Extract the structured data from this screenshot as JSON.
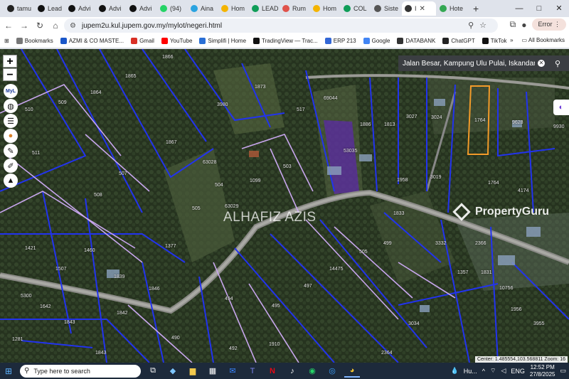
{
  "browser": {
    "tabs": [
      {
        "label": "tamu",
        "icon": "github-icon",
        "color": "#222222"
      },
      {
        "label": "Lead",
        "icon": "tiktok-icon",
        "color": "#111111"
      },
      {
        "label": "Advi",
        "icon": "tiktok-icon",
        "color": "#111111"
      },
      {
        "label": "Advi",
        "icon": "tiktok-icon",
        "color": "#111111"
      },
      {
        "label": "Advi",
        "icon": "tiktok-icon",
        "color": "#111111"
      },
      {
        "label": "(94)",
        "icon": "whatsapp-icon",
        "color": "#25d366"
      },
      {
        "label": "Aina",
        "icon": "telegram-icon",
        "color": "#2aa3e0"
      },
      {
        "label": "Hom",
        "icon": "drive-icon",
        "color": "#f4b400"
      },
      {
        "label": "LEAD",
        "icon": "sheets-icon",
        "color": "#0f9d58"
      },
      {
        "label": "Rum",
        "icon": "rumah-icon",
        "color": "#e0524a"
      },
      {
        "label": "Hom",
        "icon": "drive-icon",
        "color": "#f4b400"
      },
      {
        "label": "COL",
        "icon": "sheets-icon",
        "color": "#0f9d58"
      },
      {
        "label": "Siste",
        "icon": "globe-icon",
        "color": "#555555"
      },
      {
        "label": "I",
        "icon": "mylot-icon",
        "color": "#333333",
        "active": true
      },
      {
        "label": "Hote",
        "icon": "maps-pin-icon",
        "color": "#34a853"
      }
    ],
    "new_tab": "+",
    "window_controls": [
      "—",
      "□",
      "✕"
    ],
    "url": "jupem2u.kul.jupem.gov.my/mylot/negeri.html",
    "error_label": "Error",
    "bookmarks": [
      {
        "label": "Bookmarks",
        "color": "#777777"
      },
      {
        "label": "AZMI & CO MASTE...",
        "color": "#1a57c9"
      },
      {
        "label": "Gmail",
        "color": "#d93025"
      },
      {
        "label": "YouTube",
        "color": "#ff0000"
      },
      {
        "label": "Simplifi | Home",
        "color": "#2a6fd6"
      },
      {
        "label": "TradingView — Trac...",
        "color": "#111111"
      },
      {
        "label": "ERP 213",
        "color": "#3367d6"
      },
      {
        "label": "Google",
        "color": "#4285f4"
      },
      {
        "label": "DATABANK",
        "color": "#333333"
      },
      {
        "label": "ChatGPT",
        "color": "#222222"
      },
      {
        "label": "TikTok",
        "color": "#111111"
      }
    ],
    "bookmarks_overflow": "»",
    "all_bookmarks": "All Bookmarks"
  },
  "map": {
    "zoom_in": "+",
    "zoom_out": "−",
    "side_tools": [
      "mylot-logo-icon",
      "globe-icon",
      "layers-icon",
      "user-pin-icon",
      "measure-icon",
      "draw-icon",
      "north-arrow-icon"
    ],
    "search_text": "Jalan Besar, Kampung Ulu Pulai, Iskandar Puteri",
    "watermark": "ALHAFIZ AZIS",
    "brand": "PropertyGuru",
    "coords_text": "Center: 1.485554,103.568811   Zoom: 16",
    "lot_labels": [
      {
        "text": "1866"
      },
      {
        "text": "1864"
      },
      {
        "text": "1865"
      },
      {
        "text": "509"
      },
      {
        "text": "510"
      },
      {
        "text": "3980"
      },
      {
        "text": "1867"
      },
      {
        "text": "1873"
      },
      {
        "text": "517"
      },
      {
        "text": "69044"
      },
      {
        "text": "1886"
      },
      {
        "text": "1813"
      },
      {
        "text": "3027"
      },
      {
        "text": "3024"
      },
      {
        "text": "1764"
      },
      {
        "text": "9628"
      },
      {
        "text": "9930"
      },
      {
        "text": "511"
      },
      {
        "text": "507"
      },
      {
        "text": "63028"
      },
      {
        "text": "503"
      },
      {
        "text": "53035"
      },
      {
        "text": "508"
      },
      {
        "text": "504"
      },
      {
        "text": "1099"
      },
      {
        "text": "505"
      },
      {
        "text": "63029"
      },
      {
        "text": "1958"
      },
      {
        "text": "3019"
      },
      {
        "text": "1764"
      },
      {
        "text": "4174"
      },
      {
        "text": "1421"
      },
      {
        "text": "1460"
      },
      {
        "text": "1507"
      },
      {
        "text": "1839"
      },
      {
        "text": "505"
      },
      {
        "text": "1377"
      },
      {
        "text": "499"
      },
      {
        "text": "3332"
      },
      {
        "text": "2366"
      },
      {
        "text": "1833"
      },
      {
        "text": "1831"
      },
      {
        "text": "1846"
      },
      {
        "text": "5300"
      },
      {
        "text": "1642"
      },
      {
        "text": "1843"
      },
      {
        "text": "1842"
      },
      {
        "text": "494"
      },
      {
        "text": "497"
      },
      {
        "text": "14475"
      },
      {
        "text": "1357"
      },
      {
        "text": "10756"
      },
      {
        "text": "495"
      },
      {
        "text": "1956"
      },
      {
        "text": "3955"
      },
      {
        "text": "3034"
      },
      {
        "text": "1281"
      },
      {
        "text": "490"
      },
      {
        "text": "492"
      },
      {
        "text": "1910"
      },
      {
        "text": "2364"
      },
      {
        "text": "1843"
      }
    ]
  },
  "taskbar": {
    "search_placeholder": "Type here to search",
    "weather": "Hu...",
    "lang": "ENG",
    "time": "12:52 PM",
    "date": "27/8/2025"
  }
}
